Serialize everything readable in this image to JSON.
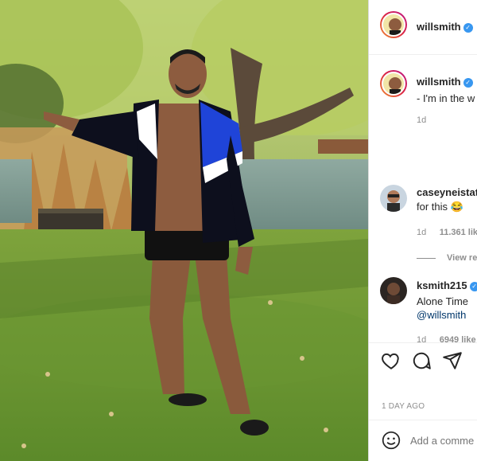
{
  "header": {
    "username": "willsmith"
  },
  "caption": {
    "username": "willsmith",
    "text": "- I'm in the w",
    "time": "1d"
  },
  "comments": [
    {
      "username": "caseyneistat",
      "text": "for this 😂",
      "time": "1d",
      "likes": "11.361 lik",
      "view_replies": "View re"
    },
    {
      "username": "ksmith215",
      "text_line1": "Alone Time",
      "mention": "@willsmith",
      "time": "1d",
      "likes": "6949 like"
    }
  ],
  "post_date": "1 DAY AGO",
  "add_comment": {
    "placeholder": "Add a comme"
  },
  "colors": {
    "verified": "#3897f0",
    "text": "#262626",
    "muted": "#8e8e8e",
    "link": "#00376b"
  },
  "icons": [
    "heart-icon",
    "comment-icon",
    "share-icon",
    "emoji-icon",
    "verified-badge-icon"
  ]
}
